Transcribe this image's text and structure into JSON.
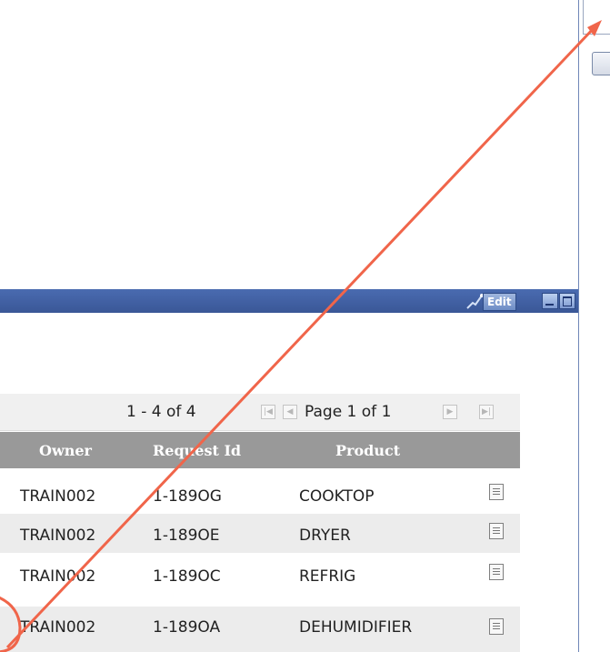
{
  "portlet": {
    "edit_label": "Edit"
  },
  "pagination": {
    "range": "1 - 4 of 4",
    "page": "Page 1 of 1"
  },
  "table": {
    "headers": [
      "Owner",
      "Request Id",
      "Product"
    ],
    "rows": [
      {
        "owner": "TRAIN002",
        "request_id": "1-189OG",
        "product": "COOKTOP"
      },
      {
        "owner": "TRAIN002",
        "request_id": "1-189OE",
        "product": "DRYER"
      },
      {
        "owner": "TRAIN002",
        "request_id": "1-189OC",
        "product": "REFRIG"
      },
      {
        "owner": "TRAIN002",
        "request_id": "1-189OA",
        "product": "DEHUMIDIFIER"
      }
    ]
  },
  "icons": {
    "customize": "customize-icon",
    "minimize": "minimize-icon",
    "maximize": "maximize-icon",
    "first_page": "first-page-icon",
    "prev_page": "previous-page-icon",
    "next_page": "next-page-icon",
    "last_page": "last-page-icon",
    "row_detail": "document-icon"
  },
  "colors": {
    "portlet_bar": "#3a5797",
    "table_header": "#999999",
    "annotation": "#f0654a"
  }
}
